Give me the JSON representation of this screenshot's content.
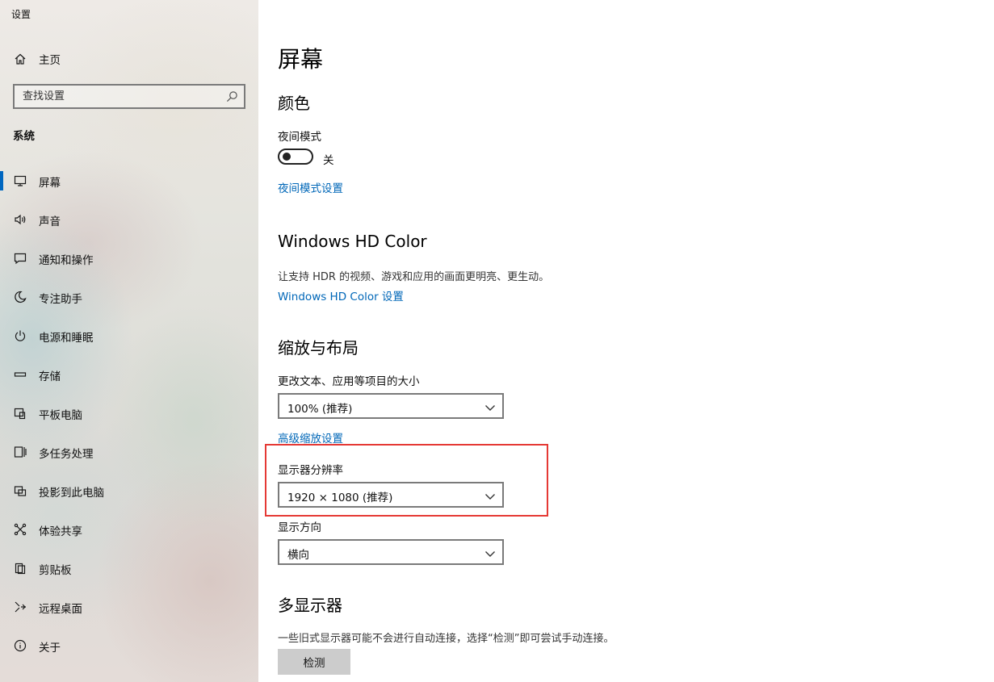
{
  "app": {
    "title": "设置"
  },
  "sidebar": {
    "home": {
      "label": "主页",
      "icon": "home-icon"
    },
    "search": {
      "placeholder": "查找设置",
      "icon": "search-icon"
    },
    "section": "系统",
    "items": [
      {
        "label": "屏幕",
        "icon": "monitor-icon",
        "active": true
      },
      {
        "label": "声音",
        "icon": "speaker-icon"
      },
      {
        "label": "通知和操作",
        "icon": "message-icon"
      },
      {
        "label": "专注助手",
        "icon": "moon-icon"
      },
      {
        "label": "电源和睡眠",
        "icon": "power-icon"
      },
      {
        "label": "存储",
        "icon": "storage-icon"
      },
      {
        "label": "平板电脑",
        "icon": "tablet-icon"
      },
      {
        "label": "多任务处理",
        "icon": "multitask-icon"
      },
      {
        "label": "投影到此电脑",
        "icon": "project-icon"
      },
      {
        "label": "体验共享",
        "icon": "share-icon"
      },
      {
        "label": "剪贴板",
        "icon": "clipboard-icon"
      },
      {
        "label": "远程桌面",
        "icon": "remote-icon"
      },
      {
        "label": "关于",
        "icon": "info-icon"
      }
    ]
  },
  "main": {
    "title": "屏幕",
    "color": {
      "heading": "颜色",
      "night_mode_label": "夜间模式",
      "night_mode_state": "关",
      "night_mode_on": false,
      "night_mode_link": "夜间模式设置"
    },
    "hdr": {
      "heading": "Windows HD Color",
      "description": "让支持 HDR 的视频、游戏和应用的画面更明亮、更生动。",
      "link": "Windows HD Color 设置"
    },
    "scale": {
      "heading": "缩放与布局",
      "size_label": "更改文本、应用等项目的大小",
      "size_value": "100% (推荐)",
      "advanced_link": "高级缩放设置",
      "resolution_label": "显示器分辨率",
      "resolution_value": "1920 × 1080 (推荐)",
      "orientation_label": "显示方向",
      "orientation_value": "横向"
    },
    "multi": {
      "heading": "多显示器",
      "description": "一些旧式显示器可能不会进行自动连接，选择“检测”即可尝试手动连接。",
      "detect_button": "检测"
    }
  },
  "colors": {
    "accent": "#0067c0",
    "link": "#0067b8",
    "highlight": "#e53935"
  }
}
